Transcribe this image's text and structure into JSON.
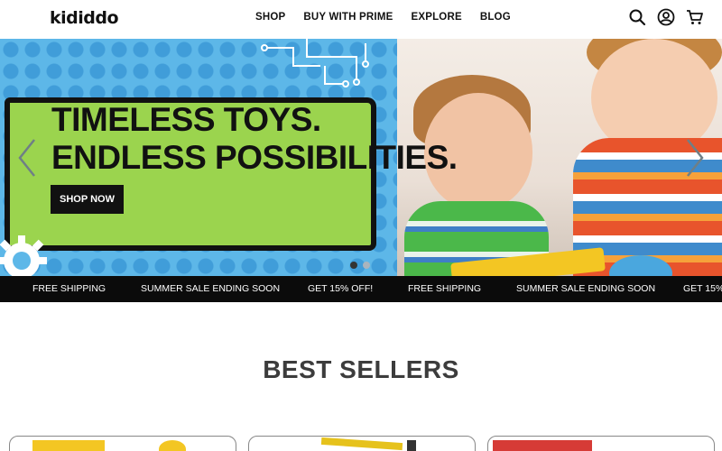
{
  "brand": {
    "logo_text": "kididdo"
  },
  "nav": {
    "items": [
      "SHOP",
      "BUY WITH PRIME",
      "EXPLORE",
      "BLOG"
    ]
  },
  "header_icons": [
    "search-icon",
    "account-icon",
    "cart-icon"
  ],
  "hero": {
    "title_line1": "TIMELESS TOYS.",
    "title_line2": "ENDLESS POSSIBILITIES.",
    "cta_label": "SHOP NOW",
    "slide_count": 2,
    "active_slide": 1
  },
  "ticker": {
    "items": [
      "FREE SHIPPING",
      "SUMMER SALE ENDING SOON",
      "GET 15% OFF!",
      "FREE SHIPPING",
      "SUMMER SALE ENDING SOON",
      "GET 15%"
    ]
  },
  "best_sellers": {
    "title": "BEST SELLERS"
  },
  "colors": {
    "hero_blue": "#5db7e8",
    "hero_green": "#9bd44e",
    "ticker_bg": "#0b0b0b",
    "accent_black": "#111111"
  }
}
